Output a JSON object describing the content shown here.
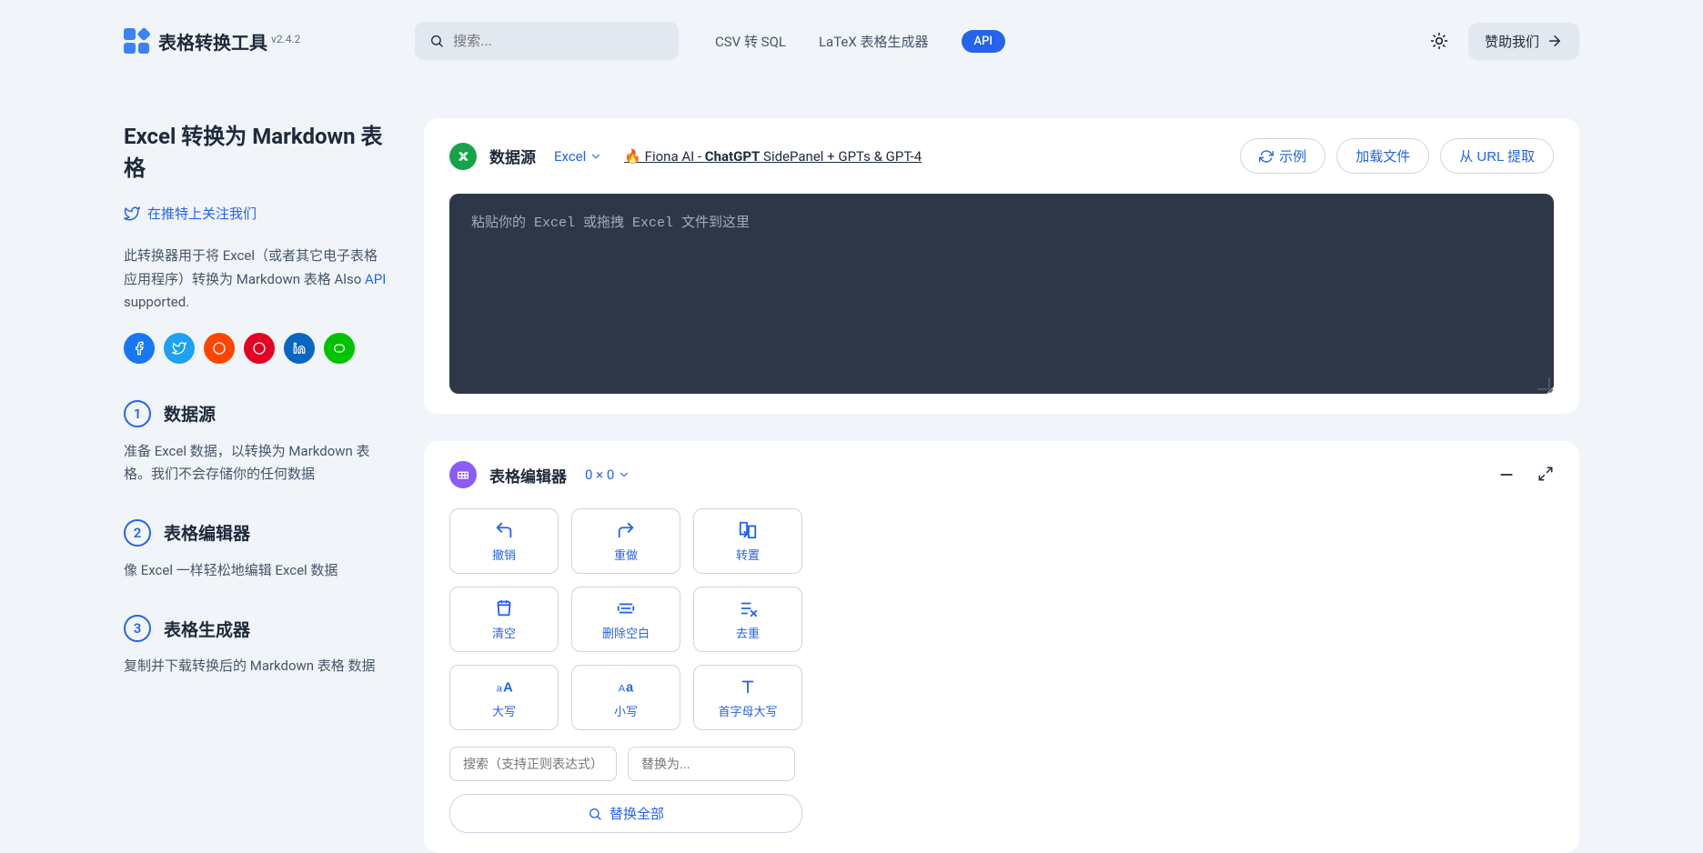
{
  "header": {
    "app_name": "表格转换工具",
    "version": "v2.4.2",
    "search_placeholder": "搜索...",
    "nav": {
      "csv_to_sql": "CSV 转 SQL",
      "latex_gen": "LaTeX 表格生成器",
      "api": "API"
    },
    "sponsor": "赞助我们"
  },
  "sidebar": {
    "title": "Excel 转换为 Markdown 表格",
    "twitter": "在推特上关注我们",
    "desc_part1": "此转换器用于将 Excel（或者其它电子表格应用程序）转换为 Markdown 表格 Also ",
    "desc_api": "API",
    "desc_part2": " supported.",
    "steps": [
      {
        "num": "1",
        "title": "数据源",
        "desc": "准备 Excel 数据，以转换为 Markdown 表格。我们不会存储你的任何数据"
      },
      {
        "num": "2",
        "title": "表格编辑器",
        "desc": "像 Excel 一样轻松地编辑 Excel 数据"
      },
      {
        "num": "3",
        "title": "表格生成器",
        "desc": "复制并下载转换后的 Markdown 表格 数据"
      }
    ]
  },
  "source_card": {
    "title": "数据源",
    "selector": "Excel",
    "promo_pre": "🔥 Fiona AI - ",
    "promo_bold": "ChatGPT",
    "promo_post": " SidePanel + GPTs & GPT-4",
    "actions": {
      "example": "示例",
      "load_file": "加载文件",
      "from_url": "从 URL 提取"
    },
    "textarea_placeholder": "粘贴你的 Excel 或拖拽 Excel 文件到这里"
  },
  "editor_card": {
    "title": "表格编辑器",
    "dimensions": "0 × 0",
    "tools": {
      "undo": "撤销",
      "redo": "重做",
      "transpose": "转置",
      "clear": "清空",
      "trim": "删除空白",
      "dedupe": "去重",
      "upper": "大写",
      "lower": "小写",
      "cap": "首字母大写"
    },
    "search_placeholder": "搜索（支持正则表达式）",
    "replace_placeholder": "替换为...",
    "replace_all": "替换全部"
  },
  "colors": {
    "facebook": "#1877f2",
    "twitter": "#1da1f2",
    "reddit": "#ff4500",
    "pinterest": "#e60023",
    "linkedin": "#0a66c2",
    "line": "#00c300"
  }
}
